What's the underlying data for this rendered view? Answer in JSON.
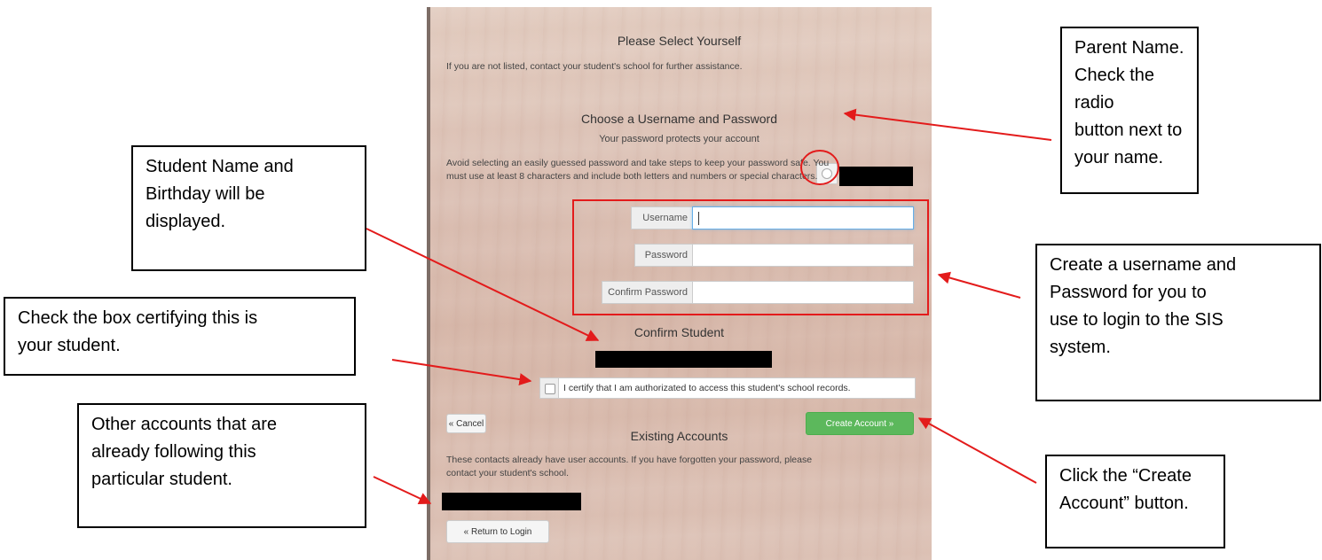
{
  "form": {
    "select_title": "Please Select Yourself",
    "select_help": "If you are not listed, contact your student's school for further assistance.",
    "credentials_title": "Choose a Username and Password",
    "credentials_subtitle": "Your password protects your account",
    "password_help_line1": "Avoid selecting an easily guessed password and take steps to keep your password safe. You",
    "password_help_line2": "must use at least 8 characters and include both letters and numbers or special characters.",
    "username_label": "Username",
    "username_value": "",
    "password_label": "Password",
    "password_value": "",
    "confirm_label": "Confirm Password",
    "confirm_value": "",
    "confirm_student_title": "Confirm Student",
    "certify_label": "I certify that I am authorizated to access this student's school records.",
    "cancel_label": "« Cancel",
    "create_label": "Create Account »",
    "existing_title": "Existing Accounts",
    "existing_help_line1": "These contacts already have user accounts. If you have forgotten your password, please",
    "existing_help_line2": "contact your student's school.",
    "return_label": "« Return to Login"
  },
  "callouts": {
    "parent_name": [
      "Parent Name.",
      "Check the radio",
      "button next to",
      "your name."
    ],
    "student_info": [
      "Student Name and",
      "Birthday will be",
      "displayed."
    ],
    "certify": [
      "Check the box certifying this is",
      "your student."
    ],
    "other_accounts": [
      "Other accounts that are",
      "already following this",
      "particular student."
    ],
    "credentials": [
      "Create a username and",
      "Password for you to",
      "use to login to the SIS",
      "system."
    ],
    "create_button": [
      "Click the “Create",
      "Account” button."
    ]
  },
  "colors": {
    "annotation_red": "#e31b1b",
    "create_button_green": "#5cb85c"
  }
}
